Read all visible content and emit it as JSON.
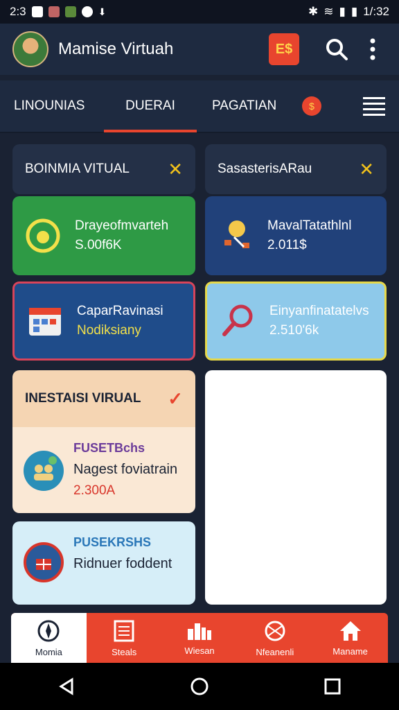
{
  "status": {
    "time_left": "2:3",
    "time_right": "1/:32"
  },
  "header": {
    "title": "Mamise Virtuah",
    "badge_label": "E$"
  },
  "tabs": [
    {
      "label": "LINOUNIAS"
    },
    {
      "label": "DUERAI"
    },
    {
      "label": "PAGATIAN"
    }
  ],
  "tab_badge": "$",
  "panels": {
    "left_header": "BOINMIA VITUAL",
    "right_header": "SasasterisARau"
  },
  "stats": [
    {
      "label": "Drayeofmvarteh",
      "value": "S.00f6K",
      "color": "#2e9a45"
    },
    {
      "label": "MavalTatathlnl",
      "value": "2.011$",
      "color": "#21417a"
    },
    {
      "label": "CaparRavinasi",
      "value": "Nodiksiany",
      "color": "#1f4c8a"
    },
    {
      "label": "Einyanfinatatelvs",
      "value": "2.510'6k",
      "color": "#8ec9ea"
    }
  ],
  "investments": {
    "header": "INESTAISI VIRUAL",
    "item1": {
      "tag": "FUSETBchs",
      "name": "Nagest foviatrain",
      "amount": "2.300A"
    },
    "item2": {
      "tag": "PUSEKRSHS",
      "name": "Ridnuer foddent"
    }
  },
  "bottom_nav": [
    {
      "label": "Momia",
      "icon": "compass-icon"
    },
    {
      "label": "Steals",
      "icon": "document-icon"
    },
    {
      "label": "Wiesan",
      "icon": "grid-icon"
    },
    {
      "label": "Nfeanenli",
      "icon": "network-icon"
    },
    {
      "label": "Maname",
      "icon": "home-icon"
    }
  ],
  "colors": {
    "accent": "#e8452e",
    "background": "#1a2233",
    "highlight": "#f2c21b"
  }
}
